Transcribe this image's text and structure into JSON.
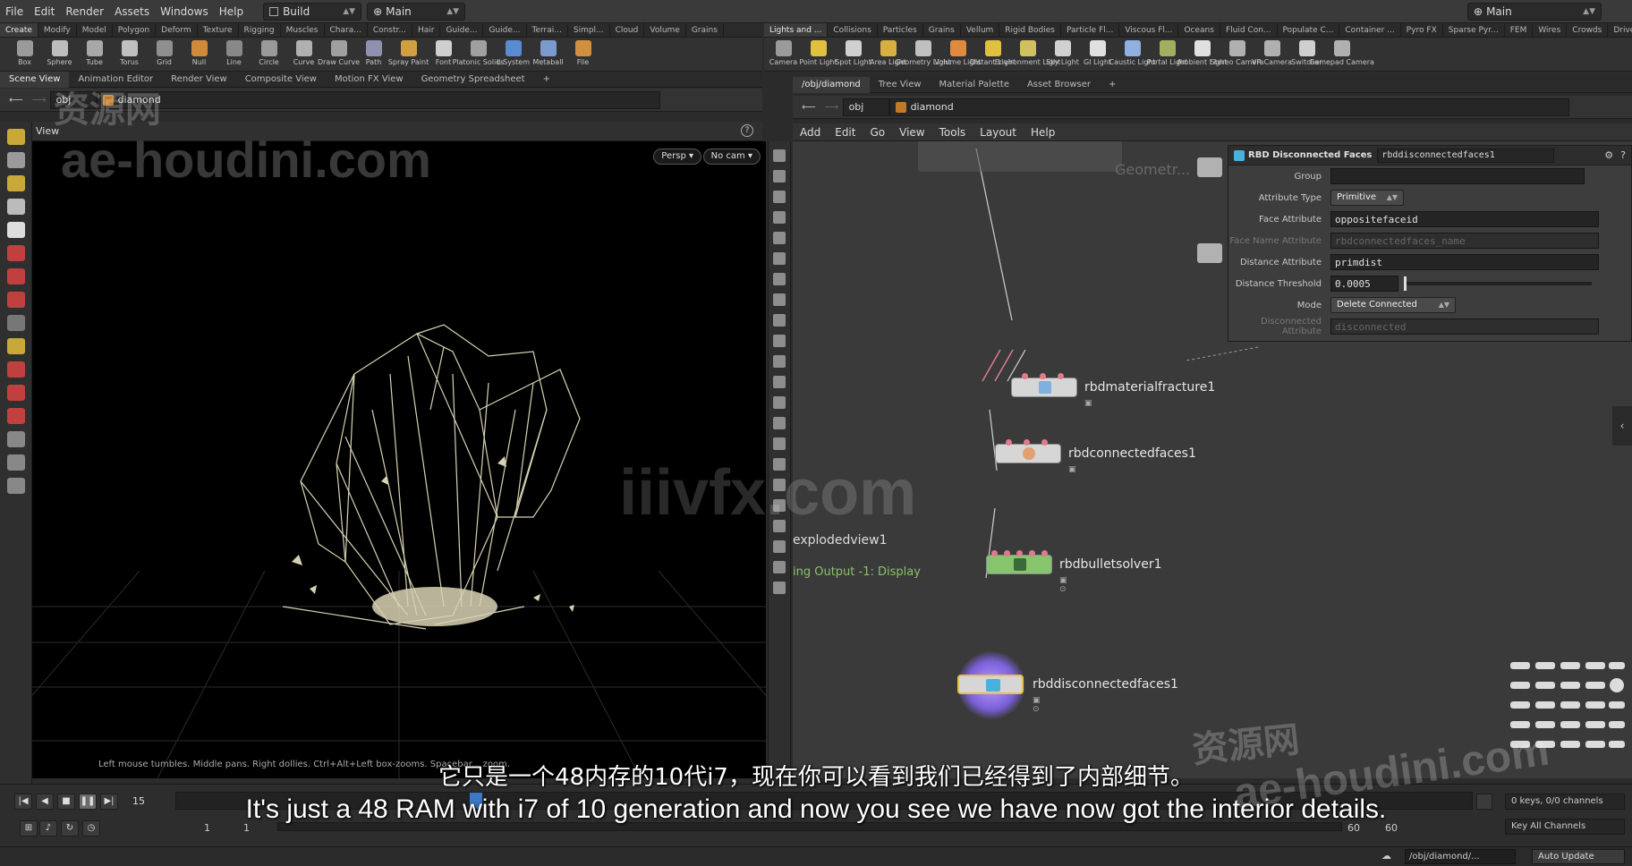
{
  "menubar": {
    "items": [
      "File",
      "Edit",
      "Render",
      "Assets",
      "Windows",
      "Help"
    ],
    "desktop": "Build",
    "context": "Main",
    "right_context": "Main"
  },
  "shelf_left": {
    "tabs": [
      "Create",
      "Modify",
      "Model",
      "Polygon",
      "Deform",
      "Texture",
      "Rigging",
      "Muscles",
      "Chara...",
      "Constr...",
      "Hair",
      "Guide...",
      "Guide...",
      "Terrai...",
      "Simpl...",
      "Cloud",
      "Volume",
      "Grains"
    ],
    "tools": [
      "Box",
      "Sphere",
      "Tube",
      "Torus",
      "Grid",
      "Null",
      "Line",
      "Circle",
      "Curve",
      "Draw Curve",
      "Path",
      "Spray Paint",
      "Font",
      "Platonic Solids",
      "L-System",
      "Metaball",
      "File"
    ]
  },
  "shelf_right": {
    "tabs": [
      "Lights and ...",
      "Collisions",
      "Particles",
      "Grains",
      "Vellum",
      "Rigid Bodies",
      "Particle Fl...",
      "Viscous Fl...",
      "Oceans",
      "Fluid Con...",
      "Populate C...",
      "Container ...",
      "Pyro FX",
      "Sparse Pyr...",
      "FEM",
      "Wires",
      "Crowds",
      "Drive Sim"
    ],
    "tools": [
      "Camera",
      "Point Light",
      "Spot Light",
      "Area Light",
      "Geometry Light",
      "Volume Light",
      "Distant Light",
      "Environment Light",
      "Sky Light",
      "GI Light",
      "Caustic Light",
      "Portal Light",
      "Ambient Light",
      "Stereo Camera",
      "VR Camera",
      "Switcher",
      "Gamepad Camera"
    ]
  },
  "left_panetabs": [
    "Scene View",
    "Animation Editor",
    "Render View",
    "Composite View",
    "Motion FX View",
    "Geometry Spreadsheet"
  ],
  "right_panetabs": [
    "/obj/diamond",
    "Tree View",
    "Material Palette",
    "Asset Browser"
  ],
  "left_path": {
    "obj": "obj",
    "node": "diamond"
  },
  "right_path": {
    "obj": "obj",
    "node": "diamond"
  },
  "viewport": {
    "title": "View",
    "persp": "Persp",
    "cam": "No cam",
    "help": "Left mouse tumbles. Middle pans. Right dollies. Ctrl+Alt+Left box-zooms. Spacebar... zoom."
  },
  "network_menu": [
    "Add",
    "Edit",
    "Go",
    "View",
    "Tools",
    "Layout",
    "Help"
  ],
  "network": {
    "faded_top": "Geometr...",
    "nodes": [
      {
        "name": "rbdmaterialfracture1"
      },
      {
        "name": "rbdconnectedfaces1"
      },
      {
        "name": "rbdbulletsolver1"
      },
      {
        "name": "rbddisconnectedfaces1"
      }
    ],
    "side_label_1": "explodedview1",
    "side_label_2": "ing Output -1: Display"
  },
  "params": {
    "type": "RBD Disconnected Faces",
    "name": "rbddisconnectedfaces1",
    "rows": [
      {
        "label": "Group",
        "value": ""
      },
      {
        "label": "Attribute Type",
        "value": "Primitive"
      },
      {
        "label": "Face Attribute",
        "value": "oppositefaceid"
      },
      {
        "label": "Face Name Attribute",
        "value": "rbdconnectedfaces_name"
      },
      {
        "label": "Distance Attribute",
        "value": "primdist"
      },
      {
        "label": "Distance Threshold",
        "value": "0.0005"
      },
      {
        "label": "Mode",
        "value": "Delete Connected"
      },
      {
        "label": "Disconnected Attribute",
        "value": "disconnected"
      }
    ]
  },
  "timeline": {
    "frame": "15",
    "start": "1",
    "start2": "1",
    "end": "60",
    "end2": "60",
    "keys": "0 keys, 0/0 channels",
    "key_all": "Key All Channels",
    "auto_update": "Auto Update",
    "status_path": "/obj/diamond/..."
  },
  "subtitles": {
    "zh": "它只是一个48内存的10代i7，现在你可以看到我们已经得到了内部细节。",
    "en": "It's just a 48 RAM with i7 of 10 generation and now you see we have now got the interior details."
  },
  "watermarks": [
    "资源网",
    "ae-houdini.com",
    "iiivfx.com",
    "资源网",
    "ae-houdini.com"
  ],
  "colors": {
    "accent": "#86c56e",
    "node_body": "#d6d6d6",
    "port": "#e07a8c"
  }
}
